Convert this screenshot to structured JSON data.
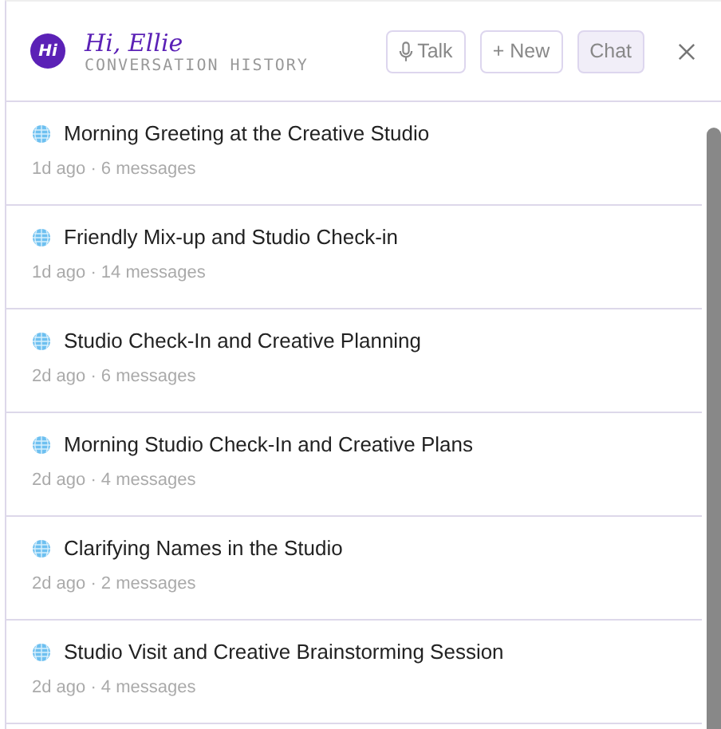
{
  "header": {
    "logo": "Hi",
    "greeting": "Hi, Ellie",
    "subtitle": "CONVERSATION HISTORY",
    "buttons": [
      {
        "label": "Talk",
        "kind": "mic",
        "selected": false
      },
      {
        "label": "+ New",
        "kind": "plain",
        "selected": false
      },
      {
        "label": "Chat",
        "kind": "plain",
        "selected": true
      }
    ]
  },
  "conversations": [
    {
      "title": "Morning Greeting at the Creative Studio",
      "meta": "1d ago · 6 messages"
    },
    {
      "title": "Friendly Mix-up and Studio Check-in",
      "meta": "1d ago · 14 messages"
    },
    {
      "title": "Studio Check-In and Creative Planning",
      "meta": "2d ago · 6 messages"
    },
    {
      "title": "Morning Studio Check-In and Creative Plans",
      "meta": "2d ago · 4 messages"
    },
    {
      "title": "Clarifying Names in the Studio",
      "meta": "2d ago · 2 messages"
    },
    {
      "title": "Studio Visit and Creative Brainstorming Session",
      "meta": "2d ago · 4 messages"
    }
  ]
}
